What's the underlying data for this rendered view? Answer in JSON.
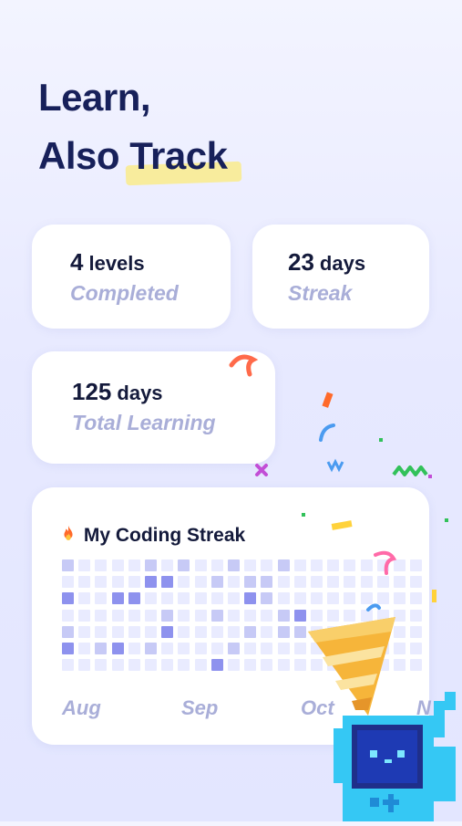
{
  "headline": {
    "line1": "Learn,",
    "line2_plain": "Also",
    "line2_highlight": "Track"
  },
  "stats": {
    "levels": {
      "number": "4",
      "unit": "levels",
      "label": "Completed"
    },
    "streak": {
      "number": "23",
      "unit": "days",
      "label": "Streak"
    },
    "total": {
      "number": "125",
      "unit": "days",
      "label": "Total Learning"
    }
  },
  "coding_streak": {
    "icon": "fire-icon",
    "title": "My Coding Streak",
    "months": [
      "Aug",
      "Sep",
      "Oct",
      "N"
    ],
    "levels": [
      [
        1,
        0,
        0,
        0,
        0,
        1,
        0,
        1,
        0,
        0,
        1,
        0,
        0,
        1,
        0,
        0,
        0,
        0,
        0,
        0,
        0,
        0
      ],
      [
        0,
        0,
        0,
        0,
        0,
        2,
        2,
        0,
        0,
        1,
        0,
        1,
        1,
        0,
        0,
        0,
        0,
        0,
        0,
        0,
        0,
        0
      ],
      [
        2,
        0,
        0,
        2,
        2,
        0,
        0,
        0,
        0,
        0,
        0,
        2,
        1,
        0,
        0,
        0,
        0,
        0,
        0,
        0,
        0,
        0
      ],
      [
        0,
        0,
        0,
        0,
        0,
        0,
        1,
        0,
        0,
        1,
        0,
        0,
        0,
        1,
        2,
        0,
        0,
        0,
        0,
        0,
        0,
        0
      ],
      [
        1,
        0,
        0,
        0,
        0,
        0,
        2,
        0,
        0,
        0,
        0,
        1,
        0,
        1,
        1,
        0,
        0,
        0,
        0,
        0,
        0,
        0
      ],
      [
        2,
        0,
        1,
        2,
        0,
        1,
        0,
        0,
        0,
        0,
        1,
        0,
        0,
        0,
        0,
        0,
        0,
        0,
        0,
        0,
        0,
        0
      ],
      [
        0,
        0,
        0,
        0,
        0,
        0,
        0,
        0,
        0,
        2,
        0,
        0,
        0,
        0,
        0,
        0,
        0,
        0,
        0,
        0,
        0,
        0
      ]
    ],
    "colors": {
      "empty": "#e9ebff",
      "light": "#c7caf6",
      "strong": "#8e92ee"
    }
  },
  "decor": {
    "mascot": "pixel-monster-mascot",
    "party_hat": "party-hat-icon",
    "confetti": "confetti"
  }
}
